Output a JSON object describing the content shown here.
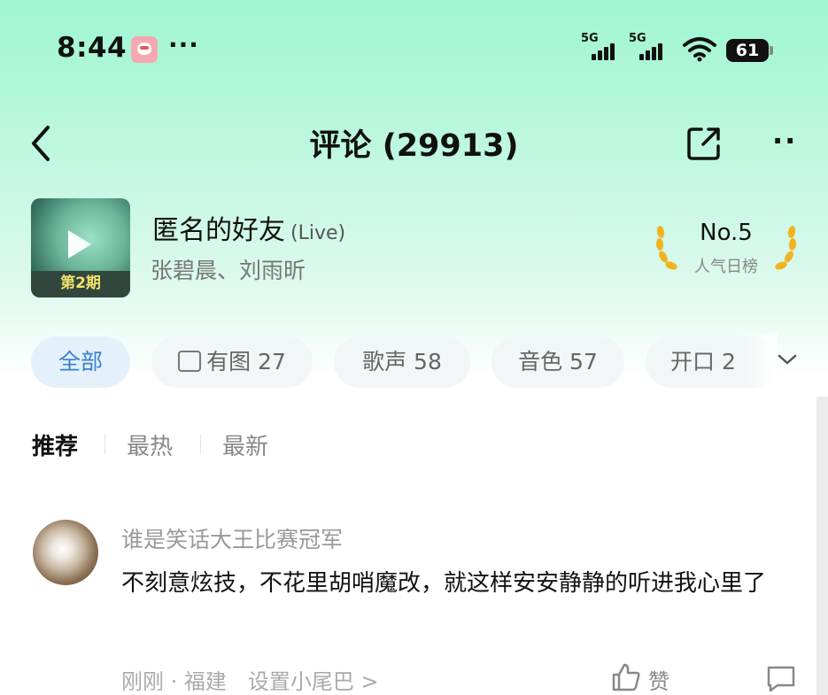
{
  "status_bar": {
    "time": "8:44",
    "more_dots": "···",
    "signal_1_label": "5G",
    "signal_2_label": "5G",
    "battery": "61"
  },
  "header": {
    "title": "评论 (29913)",
    "more": "··"
  },
  "song": {
    "cover_text": "第2期",
    "title": "匿名的好友",
    "tag": "(Live)",
    "artists": "张碧晨、刘雨昕",
    "rank": "No.5",
    "rank_label": "人气日榜"
  },
  "filters": [
    {
      "label": "全部",
      "active": true
    },
    {
      "label": "有图 27",
      "icon": "image-icon"
    },
    {
      "label": "歌声 58"
    },
    {
      "label": "音色 57"
    },
    {
      "label": "开口 2"
    }
  ],
  "sort_tabs": [
    {
      "label": "推荐",
      "active": true
    },
    {
      "label": "最热"
    },
    {
      "label": "最新"
    }
  ],
  "comment": {
    "username": "谁是笑话大王比赛冠军",
    "text": "不刻意炫技，不花里胡哨魔改，就这样安安静静的听进我心里了",
    "meta": "刚刚 · 福建",
    "tail_link": "设置小尾巴 >",
    "like_label": "赞"
  },
  "colors": {
    "accent": "#3b7fcf",
    "gradient_top": "#9ff6d2",
    "laurel": "#f2b320"
  }
}
